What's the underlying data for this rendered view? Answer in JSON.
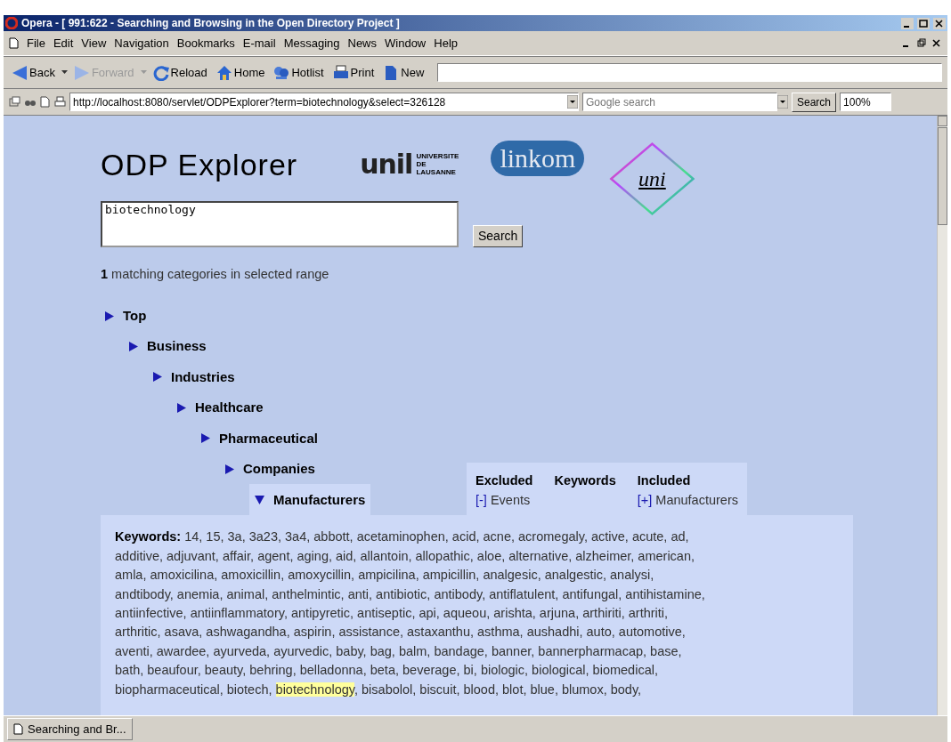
{
  "window": {
    "title": "Opera - [ 991:622 - Searching and Browsing in the Open Directory Project ]"
  },
  "menu": [
    "File",
    "Edit",
    "View",
    "Navigation",
    "Bookmarks",
    "E-mail",
    "Messaging",
    "News",
    "Window",
    "Help"
  ],
  "toolbar": [
    {
      "label": "Back",
      "kind": "back",
      "dropdown": true,
      "disabled": false
    },
    {
      "label": "Forward",
      "kind": "forward",
      "dropdown": true,
      "disabled": true
    },
    {
      "label": "Reload",
      "kind": "reload",
      "dropdown": false,
      "disabled": false
    },
    {
      "label": "Home",
      "kind": "home",
      "dropdown": false,
      "disabled": false
    },
    {
      "label": "Hotlist",
      "kind": "hotlist",
      "dropdown": false,
      "disabled": false
    },
    {
      "label": "Print",
      "kind": "print",
      "dropdown": false,
      "disabled": false
    },
    {
      "label": "New",
      "kind": "new",
      "dropdown": false,
      "disabled": false
    }
  ],
  "address": {
    "url": "http://localhost:8080/servlet/ODPExplorer?term=biotechnology&select=326128",
    "search_placeholder": "Google search",
    "search_button": "Search",
    "zoom": "100%"
  },
  "page": {
    "title": "ODP Explorer",
    "logos": [
      {
        "kind": "unil",
        "text": "unil",
        "subtext": "UNIVERSITE DE LAUSANNE"
      },
      {
        "kind": "linkom",
        "text": "linkom"
      },
      {
        "kind": "uni",
        "text": "uni"
      }
    ],
    "query": "biotechnology",
    "search_button": "Search",
    "result_count": "1",
    "result_text": "matching categories in selected range",
    "tree": [
      {
        "label": "Top",
        "expanded": false,
        "children": [
          {
            "label": "Business",
            "expanded": false,
            "children": [
              {
                "label": "Industries",
                "expanded": false,
                "children": [
                  {
                    "label": "Healthcare",
                    "expanded": false,
                    "children": [
                      {
                        "label": "Pharmaceutical",
                        "expanded": false,
                        "children": [
                          {
                            "label": "Companies",
                            "expanded": false,
                            "children": [
                              {
                                "label": "Manufacturers",
                                "expanded": true
                              }
                            ]
                          }
                        ]
                      }
                    ]
                  }
                ]
              }
            ]
          }
        ]
      }
    ],
    "filter_tabs": [
      {
        "heading": "Excluded",
        "sign": "[-]",
        "item": "Events"
      },
      {
        "heading": "Keywords"
      },
      {
        "heading": "Included",
        "sign": "[+]",
        "item": "Manufacturers"
      }
    ],
    "keywords": {
      "label": "Keywords:",
      "lines": [
        [
          {
            "text": " 14, 15, 3a, 3a23, 3a4, abbott, acetaminophen, acid, acne, acromegaly, active, acute, ad,",
            "highlighted": false
          }
        ],
        [
          {
            "text": "additive, adjuvant, affair, agent, aging, aid, allantoin, allopathic, aloe, alternative, alzheimer, american,",
            "highlighted": false
          }
        ],
        [
          {
            "text": "amla, amoxicilina, amoxicillin, amoxycillin, ampicilina, ampicillin, analgesic, analgestic, analysi,",
            "highlighted": false
          }
        ],
        [
          {
            "text": "andtibody, anemia, animal, anthelmintic, anti, antibiotic, antibody, antiflatulent, antifungal, antihistamine,",
            "highlighted": false
          }
        ],
        [
          {
            "text": "antiinfective, antiinflammatory, antipyretic, antiseptic, api, aqueou, arishta, arjuna, arthiriti, arthriti,",
            "highlighted": false
          }
        ],
        [
          {
            "text": "arthritic, asava, ashwagandha, aspirin, assistance, astaxanthu, asthma, aushadhi, auto, automotive,",
            "highlighted": false
          }
        ],
        [
          {
            "text": "aventi, awardee, ayurveda, ayurvedic, baby, bag, balm, bandage, banner, bannerpharmacap, base,",
            "highlighted": false
          }
        ],
        [
          {
            "text": "bath, beaufour, beauty, behring, belladonna, beta, beverage, bi, biologic, biological, biomedical,",
            "highlighted": false
          }
        ],
        [
          {
            "text": "biopharmaceutical, biotech, ",
            "highlighted": false
          },
          {
            "text": "biotechnology",
            "highlighted": true
          },
          {
            "text": ", bisabolol, biscuit, blood, blot, blue, blumox, body,",
            "highlighted": false
          }
        ]
      ]
    }
  },
  "status_bar": {
    "tab": "Searching and Br..."
  }
}
